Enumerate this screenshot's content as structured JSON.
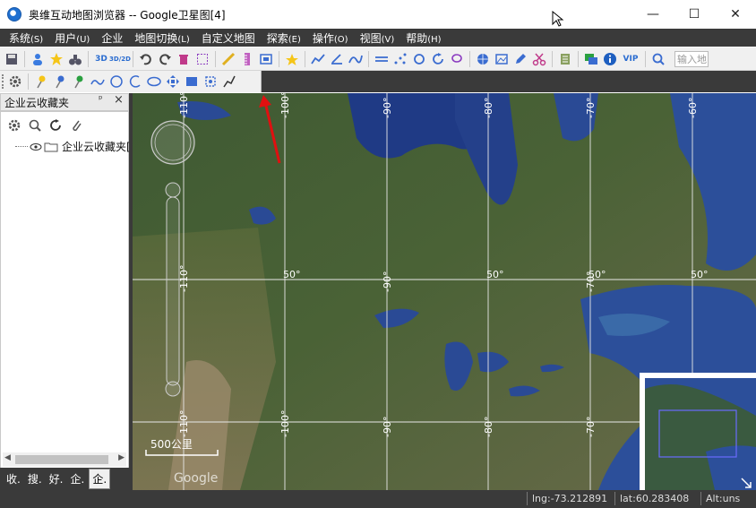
{
  "window": {
    "title": "奥维互动地图浏览器 -- Google卫星图[4]",
    "min_glyph": "—",
    "max_glyph": "☐",
    "close_glyph": "✕"
  },
  "menu": [
    {
      "label": "系统",
      "accel": "(S)"
    },
    {
      "label": "用户",
      "accel": "(U)"
    },
    {
      "label": "企业",
      "accel": ""
    },
    {
      "label": "地图切换",
      "accel": "(L)"
    },
    {
      "label": "自定义地图",
      "accel": ""
    },
    {
      "label": "探索",
      "accel": "(E)"
    },
    {
      "label": "操作",
      "accel": "(O)"
    },
    {
      "label": "视图",
      "accel": "(V)"
    },
    {
      "label": "帮助",
      "accel": "(H)"
    }
  ],
  "toolbar": {
    "btn_3d": "3D",
    "btn_3d2d": "3D/2D",
    "btn_vip": "VIP",
    "search_placeholder": "输入地"
  },
  "panel": {
    "title": "企业云收藏夹",
    "pin": "ᵖ",
    "close": "×",
    "tree_root": "企业云收藏夹[",
    "tabs": [
      "收.",
      "搜.",
      "好.",
      "企.",
      "企."
    ],
    "active_tab": 4
  },
  "map": {
    "longitude_labels_top": [
      "-110°",
      "-100°",
      "-90°",
      "-80°",
      "-70°",
      "-60°"
    ],
    "latitude_labels": [
      "50°",
      "50°",
      "50°",
      "50°"
    ],
    "longitude_labels_mid": [
      "-110°",
      "-90°",
      "-70°"
    ],
    "longitude_labels_bottom": [
      "-110°",
      "-100°",
      "-90°",
      "-80°",
      "-70°"
    ],
    "scale_label": "500公里",
    "watermark": "Google"
  },
  "status": {
    "lng": "lng:-73.212891",
    "lat": "lat:60.283408",
    "alt": "Alt:uns"
  },
  "colors": {
    "dark_bar": "#3a3a3a",
    "grid_line": "#e8e8e8",
    "ocean": "#2c4f9a",
    "land": "#4a5a30",
    "arrow": "#e01010"
  }
}
